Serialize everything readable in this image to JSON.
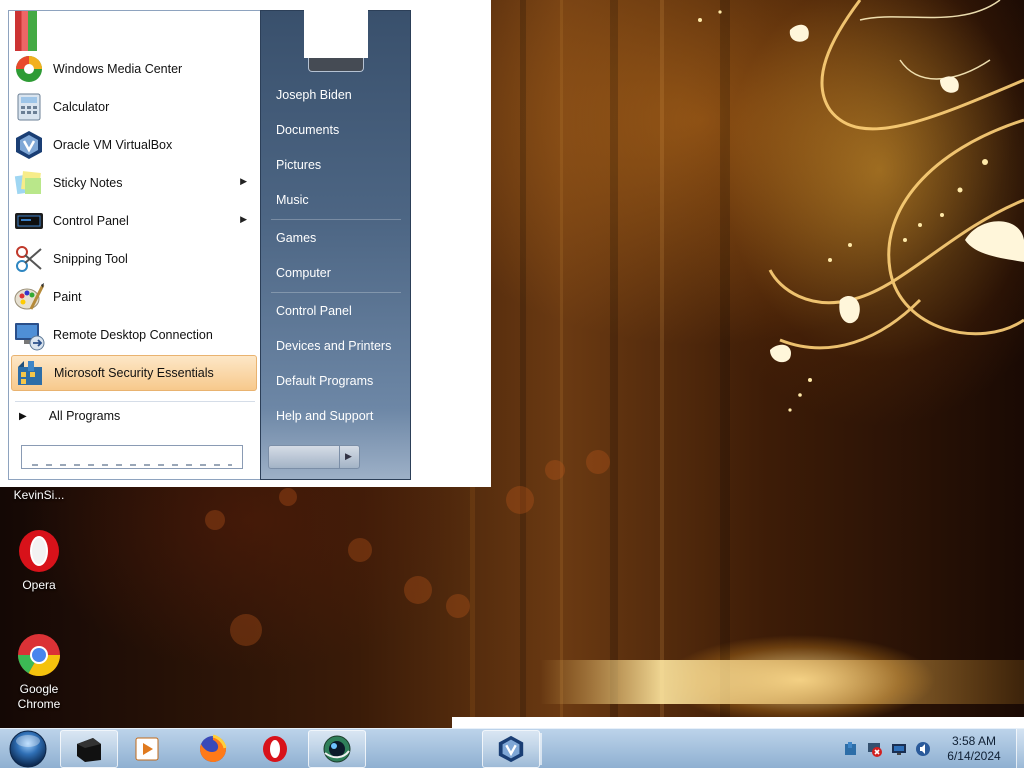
{
  "start_menu": {
    "programs": [
      {
        "label": "Windows Media Center",
        "icon": "media-center-icon",
        "submenu": false
      },
      {
        "label": "Calculator",
        "icon": "calculator-icon",
        "submenu": false
      },
      {
        "label": "Oracle VM VirtualBox",
        "icon": "virtualbox-icon",
        "submenu": false
      },
      {
        "label": "Sticky Notes",
        "icon": "sticky-notes-icon",
        "submenu": true
      },
      {
        "label": "Control Panel",
        "icon": "control-panel-icon",
        "submenu": true
      },
      {
        "label": "Snipping Tool",
        "icon": "scissors-icon",
        "submenu": false
      },
      {
        "label": "Paint",
        "icon": "paint-icon",
        "submenu": false
      },
      {
        "label": "Remote Desktop Connection",
        "icon": "remote-desktop-icon",
        "submenu": false
      },
      {
        "label": "Microsoft Security Essentials",
        "icon": "security-essentials-icon",
        "submenu": false,
        "selected": true
      }
    ],
    "all_programs_label": "All Programs",
    "right_links": [
      {
        "label": "Joseph Biden"
      },
      {
        "label": "Documents"
      },
      {
        "label": "Pictures"
      },
      {
        "label": "Music"
      },
      {
        "label": "Games"
      },
      {
        "label": "Computer"
      },
      {
        "label": "Control Panel"
      },
      {
        "label": "Devices and Printers"
      },
      {
        "label": "Default Programs"
      },
      {
        "label": "Help and Support"
      }
    ]
  },
  "desktop": {
    "icons": [
      {
        "label": "KevinSi...",
        "icon": "user-folder-icon"
      },
      {
        "label": "Opera",
        "icon": "opera-icon"
      },
      {
        "label": "Google Chrome",
        "icon": "chrome-icon"
      }
    ]
  },
  "taskbar": {
    "items": [
      {
        "name": "start-orb",
        "icon": "windows-orb-icon"
      },
      {
        "name": "terminal",
        "icon": "terminal-icon",
        "active": true
      },
      {
        "name": "media-player",
        "icon": "media-player-icon"
      },
      {
        "name": "firefox",
        "icon": "firefox-icon"
      },
      {
        "name": "opera",
        "icon": "opera-icon"
      },
      {
        "name": "app-circle",
        "icon": "globe-app-icon",
        "active": true
      },
      {
        "name": "virtualbox",
        "icon": "virtualbox-icon",
        "active": true
      }
    ],
    "tray_icons": [
      "security-shield-icon",
      "network-error-icon",
      "display-icon",
      "volume-icon"
    ],
    "clock": {
      "time": "3:58 AM",
      "date": "6/14/2024"
    }
  }
}
